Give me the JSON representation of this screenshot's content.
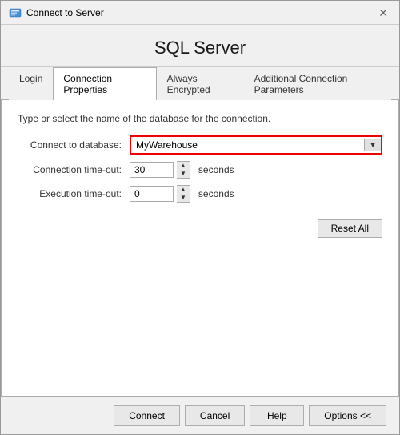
{
  "titleBar": {
    "title": "Connect to Server",
    "closeLabel": "✕"
  },
  "header": {
    "title": "SQL Server"
  },
  "tabs": [
    {
      "id": "login",
      "label": "Login",
      "active": false
    },
    {
      "id": "connection-properties",
      "label": "Connection Properties",
      "active": true
    },
    {
      "id": "always-encrypted",
      "label": "Always Encrypted",
      "active": false
    },
    {
      "id": "additional-params",
      "label": "Additional Connection Parameters",
      "active": false
    }
  ],
  "content": {
    "description": "Type or select the name of the database for the connection.",
    "connectToDatabase": {
      "label": "Connect to database:",
      "value": "MyWarehouse"
    },
    "connectionTimeout": {
      "label": "Connection time-out:",
      "value": "30",
      "unit": "seconds"
    },
    "executionTimeout": {
      "label": "Execution time-out:",
      "value": "0",
      "unit": "seconds"
    },
    "resetAllButton": "Reset All"
  },
  "footer": {
    "connectLabel": "Connect",
    "cancelLabel": "Cancel",
    "helpLabel": "Help",
    "optionsLabel": "Options <<"
  }
}
